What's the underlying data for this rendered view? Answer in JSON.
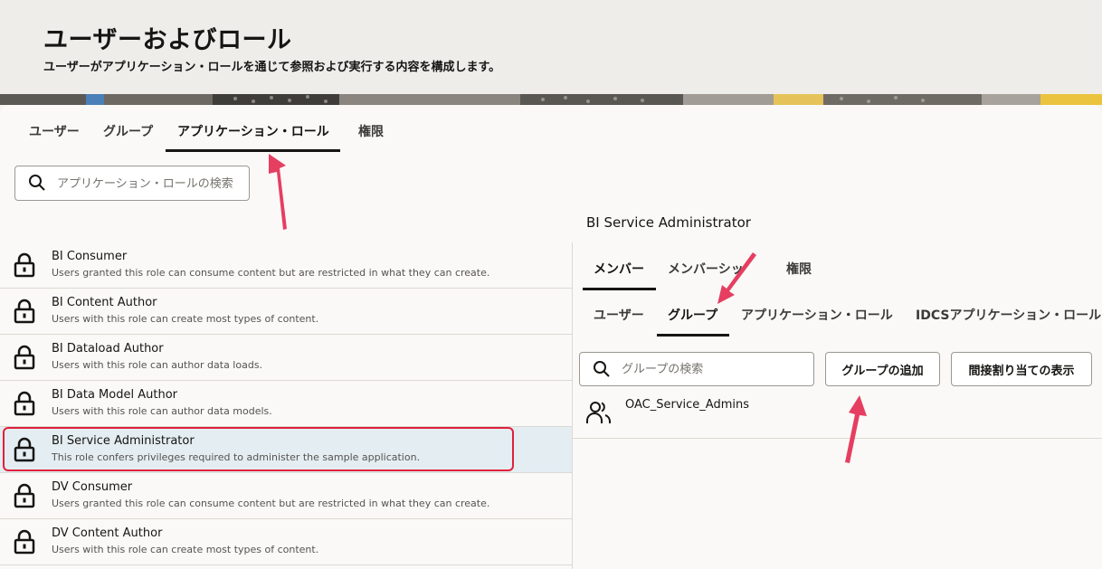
{
  "header": {
    "title": "ユーザーおよびロール",
    "subtitle": "ユーザーがアプリケーション・ロールを通じて参照および実行する内容を構成します。"
  },
  "main_tabs": [
    "ユーザー",
    "グループ",
    "アプリケーション・ロール",
    "権限"
  ],
  "main_tabs_active": "アプリケーション・ロール",
  "role_search": {
    "placeholder": "アプリケーション・ロールの検索"
  },
  "roles": [
    {
      "name": "BI Consumer",
      "description": "Users granted this role can consume content but are restricted in what they can create."
    },
    {
      "name": "BI Content Author",
      "description": "Users with this role can create most types of content."
    },
    {
      "name": "BI Dataload Author",
      "description": "Users with this role can author data loads."
    },
    {
      "name": "BI Data Model Author",
      "description": "Users with this role can author data models."
    },
    {
      "name": "BI Service Administrator",
      "description": "This role confers privileges required to administer the sample application."
    },
    {
      "name": "DV Consumer",
      "description": "Users granted this role can consume content but are restricted in what they can create."
    },
    {
      "name": "DV Content Author",
      "description": "Users with this role can create most types of content."
    }
  ],
  "selected_role": "BI Service Administrator",
  "detail": {
    "title": "BI Service Administrator",
    "tabs": [
      "メンバー",
      "メンバーシップ",
      "権限"
    ],
    "tabs_visible": [
      "メンバー",
      "メンバーシッ",
      "権限"
    ],
    "active_tab": "メンバー",
    "subtabs": [
      "ユーザー",
      "グループ",
      "アプリケーション・ロール",
      "IDCSアプリケーション・ロール"
    ],
    "active_subtab": "グループ",
    "group_search": {
      "placeholder": "グループの検索"
    },
    "add_group_button": "グループの追加",
    "show_indirect_button": "間接割り当ての表示",
    "members": [
      "OAC_Service_Admins"
    ]
  },
  "colors": {
    "accent": "#161513",
    "selection": "#e4edf2",
    "annotation": "#e0213b"
  }
}
